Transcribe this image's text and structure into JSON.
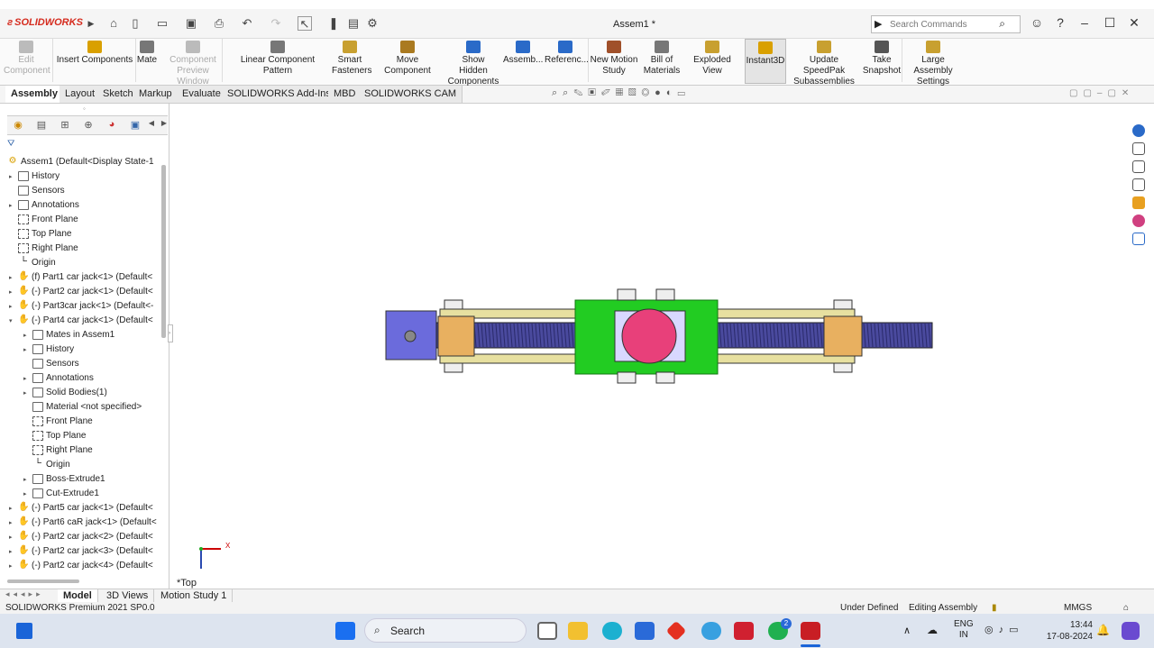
{
  "app": {
    "name": "SOLIDWORKS",
    "doc_title": "Assem1 *"
  },
  "search": {
    "placeholder": "Search Commands"
  },
  "ribbon": [
    {
      "label": "Edit\nComponent",
      "disabled": true
    },
    {
      "label": "Insert Components"
    },
    {
      "label": "Mate"
    },
    {
      "label": "Component\nPreview Window",
      "disabled": true
    },
    {
      "label": "Linear Component Pattern"
    },
    {
      "label": "Smart\nFasteners"
    },
    {
      "label": "Move Component"
    },
    {
      "label": "Show Hidden\nComponents"
    },
    {
      "label": "Assemb..."
    },
    {
      "label": "Referenc..."
    },
    {
      "label": "New Motion\nStudy"
    },
    {
      "label": "Bill of\nMaterials"
    },
    {
      "label": "Exploded View"
    },
    {
      "label": "Instant3D"
    },
    {
      "label": "Update SpeedPak\nSubassemblies"
    },
    {
      "label": "Take\nSnapshot"
    },
    {
      "label": "Large Assembly\nSettings"
    }
  ],
  "tabs": [
    "Assembly",
    "Layout",
    "Sketch",
    "Markup",
    "Evaluate",
    "SOLIDWORKS Add-Ins",
    "MBD",
    "SOLIDWORKS CAM"
  ],
  "tree": [
    {
      "level": 0,
      "label": "Assem1  (Default<Display State-1",
      "icon": "assembly"
    },
    {
      "level": 1,
      "label": "History",
      "arrow": true
    },
    {
      "level": 1,
      "label": "Sensors"
    },
    {
      "level": 1,
      "label": "Annotations",
      "arrow": true
    },
    {
      "level": 1,
      "label": "Front Plane",
      "icon": "plane"
    },
    {
      "level": 1,
      "label": "Top Plane",
      "icon": "plane"
    },
    {
      "level": 1,
      "label": "Right Plane",
      "icon": "plane"
    },
    {
      "level": 1,
      "label": "Origin",
      "icon": "origin"
    },
    {
      "level": 1,
      "label": "(f) Part1 car jack<1> (Default<",
      "icon": "part",
      "arrow": true
    },
    {
      "level": 1,
      "label": "(-) Part2 car jack<1> (Default<",
      "icon": "part",
      "arrow": true
    },
    {
      "level": 1,
      "label": "(-) Part3car jack<1> (Default<-",
      "icon": "part",
      "arrow": true
    },
    {
      "level": 1,
      "label": "(-) Part4 car jack<1> (Default<",
      "icon": "part",
      "arrow": true,
      "open": true
    },
    {
      "level": 2,
      "label": "Mates in Assem1",
      "arrow": true
    },
    {
      "level": 2,
      "label": "History",
      "arrow": true
    },
    {
      "level": 2,
      "label": "Sensors"
    },
    {
      "level": 2,
      "label": "Annotations",
      "arrow": true
    },
    {
      "level": 2,
      "label": "Solid Bodies(1)",
      "arrow": true
    },
    {
      "level": 2,
      "label": "Material <not specified>"
    },
    {
      "level": 2,
      "label": "Front Plane",
      "icon": "plane"
    },
    {
      "level": 2,
      "label": "Top Plane",
      "icon": "plane"
    },
    {
      "level": 2,
      "label": "Right Plane",
      "icon": "plane"
    },
    {
      "level": 2,
      "label": "Origin",
      "icon": "origin"
    },
    {
      "level": 2,
      "label": "Boss-Extrude1",
      "arrow": true
    },
    {
      "level": 2,
      "label": "Cut-Extrude1",
      "arrow": true
    },
    {
      "level": 1,
      "label": "(-) Part5 car jack<1> (Default<",
      "icon": "part",
      "arrow": true
    },
    {
      "level": 1,
      "label": "(-) Part6 caR jack<1> (Default<",
      "icon": "part",
      "arrow": true
    },
    {
      "level": 1,
      "label": "(-) Part2 car jack<2> (Default<",
      "icon": "part",
      "arrow": true
    },
    {
      "level": 1,
      "label": "(-) Part2 car jack<3> (Default<",
      "icon": "part",
      "arrow": true
    },
    {
      "level": 1,
      "label": "(-) Part2 car jack<4> (Default<",
      "icon": "part",
      "arrow": true
    }
  ],
  "view": {
    "orientation": "*Top",
    "triad_x": "X"
  },
  "bottom_tabs": [
    "Model",
    "3D Views",
    "Motion Study 1"
  ],
  "status": {
    "left": "SOLIDWORKS Premium 2021 SP0.0",
    "state": "Under Defined",
    "mode": "Editing Assembly",
    "units": "MMGS"
  },
  "taskbar": {
    "search": "Search",
    "lang1": "ENG",
    "lang2": "IN",
    "time": "13:44",
    "date": "17-08-2024",
    "badge": "2"
  },
  "colors": {
    "accent": "#d52b1e",
    "shaft": "#4a4a9e",
    "pivot": "#e8b060",
    "green": "#22cc22",
    "pink": "#e8407a",
    "block": "#6b6bdc"
  }
}
